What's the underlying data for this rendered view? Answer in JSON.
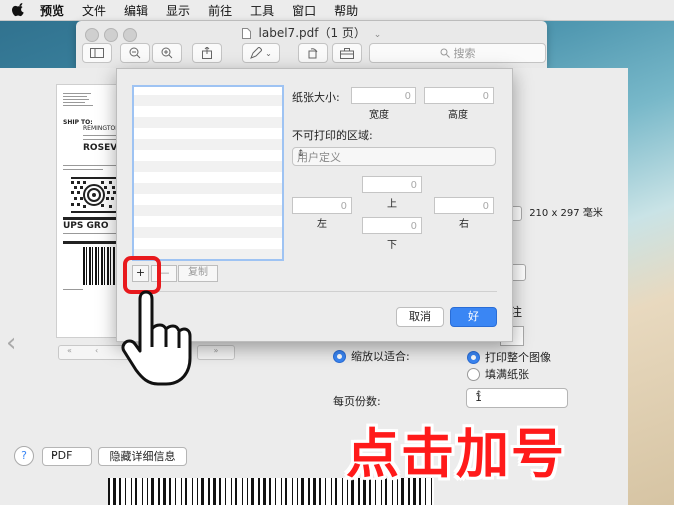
{
  "menubar": {
    "app_name": "预览",
    "items": [
      "文件",
      "编辑",
      "显示",
      "前往",
      "工具",
      "窗口",
      "帮助"
    ]
  },
  "window": {
    "title": "label7.pdf（1 页）",
    "search_placeholder": "搜索"
  },
  "document": {
    "label_lines": [
      "SHIP TO:",
      "REMINGTON",
      "UPS GRO",
      "ROSEVI"
    ]
  },
  "print_panel": {
    "paper_readout": "210 x 297 毫米",
    "note_label": "注",
    "scale_to_fit_label": "缩放以适合:",
    "print_entire_image": "打印整个图像",
    "fill_paper": "填满纸张",
    "pages_per_sheet_label": "每页份数:",
    "pages_per_sheet_value": "1",
    "help_label": "?",
    "pdf_label": "PDF",
    "hide_details_label": "隐藏详细信息"
  },
  "paper_dialog": {
    "paper_size_label": "纸张大小:",
    "width_label": "宽度",
    "height_label": "高度",
    "width_value": "0",
    "height_value": "0",
    "non_printable_label": "不可打印的区域:",
    "margins_select_value": "用户定义",
    "top_label": "上",
    "bottom_label": "下",
    "left_label": "左",
    "right_label": "右",
    "top_value": "0",
    "bottom_value": "0",
    "left_value": "0",
    "right_value": "0",
    "add_label": "+",
    "remove_label": "—",
    "duplicate_label": "复制",
    "cancel_label": "取消",
    "ok_label": "好"
  },
  "overlay": {
    "caption": "点击加号"
  },
  "colors": {
    "accent_blue": "#3a86f4",
    "highlight_red": "#e8191d",
    "caption_red": "#ff1a1a"
  }
}
